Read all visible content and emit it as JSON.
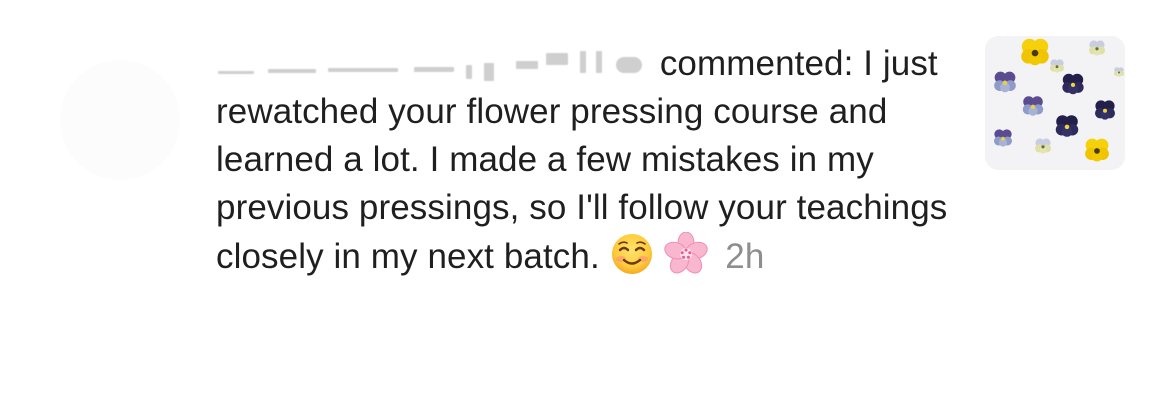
{
  "notification": {
    "action_text": "commented: I just rewatched your flower pressing course and learned a lot. I made a few mistakes in my previous pressings, so I'll follow your teachings closely in my next batch.",
    "emoji_1": "smiling-face-icon",
    "emoji_2": "cherry-blossom-icon",
    "timestamp": "2h",
    "thumbnail": "pressed-pansies-thumbnail"
  },
  "colors": {
    "text": "#1f1f1f",
    "timestamp": "#8e8e8e",
    "background": "#ffffff"
  }
}
